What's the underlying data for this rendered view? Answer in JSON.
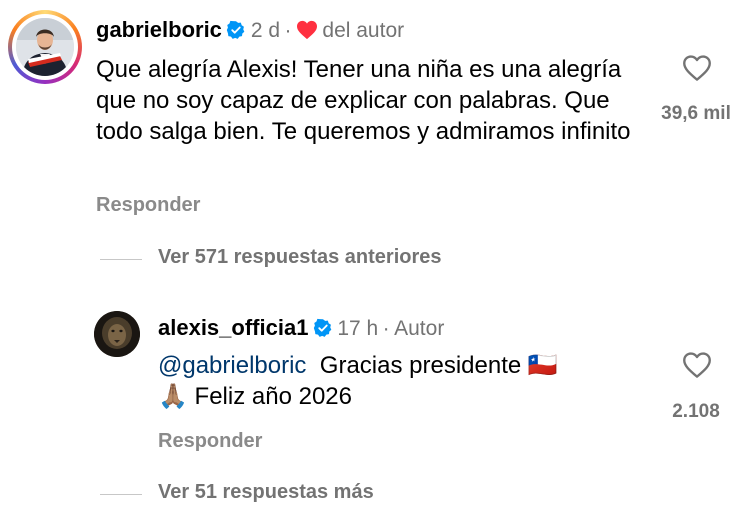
{
  "comments": [
    {
      "username": "gabrielboric",
      "time": "2 d",
      "separator": "·",
      "author_like_label": "del autor",
      "text": "Que alegría Alexis! Tener una niña es una alegría que no soy capaz de explicar con palabras. Que todo salga bien. Te queremos y admiramos infinito",
      "like_count": "39,6 mil",
      "reply_label": "Responder",
      "view_replies_label": "Ver 571 respuestas anteriores"
    },
    {
      "username": "alexis_officia1",
      "time": "17 h",
      "separator": "·",
      "author_tag": "Autor",
      "mention": "@gabrielboric",
      "text_line1": "Gracias presidente 🇨🇱",
      "text_line2": "🙏🏽 Feliz año 2026",
      "like_count": "2.108",
      "reply_label": "Responder",
      "view_more_label": "Ver 51 respuestas más"
    }
  ],
  "colors": {
    "verified": "#0095f6",
    "author_heart": "#ff3040",
    "mention": "#00376b",
    "secondary_text": "#737373"
  },
  "icons": [
    "verified-badge-icon",
    "heart-outline-icon",
    "filled-heart-icon",
    "chile-flag-emoji",
    "praying-hands-emoji"
  ]
}
